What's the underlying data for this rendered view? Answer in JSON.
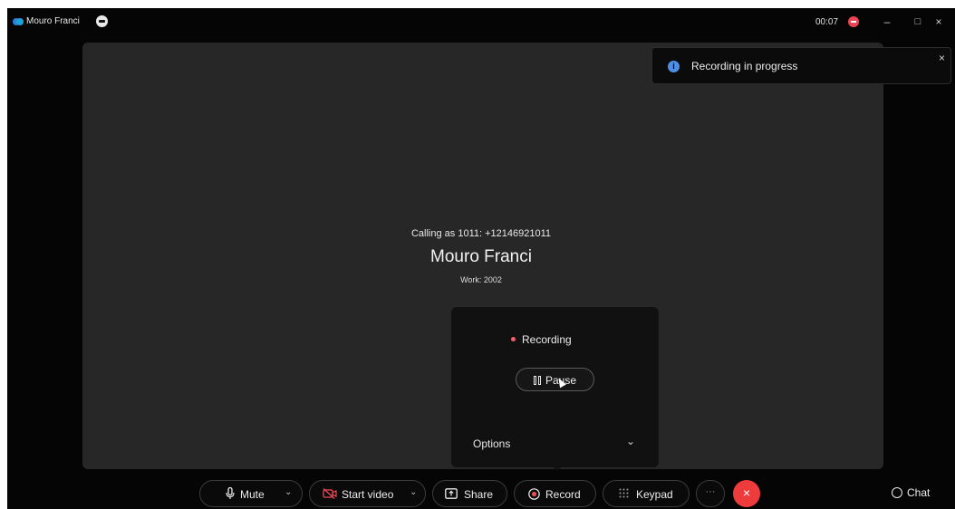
{
  "titlebar": {
    "app_name": "Mouro Franci",
    "timer": "00:07",
    "minimize": "–",
    "maximize": "□",
    "close": "×",
    "colors": {
      "recording_indicator": "#ec4452",
      "accent": "#4e8fe6"
    }
  },
  "toast": {
    "icon": "info-icon",
    "message": "Recording in progress",
    "close": "×"
  },
  "call": {
    "calling_as": "Calling as 1011: +12146921011",
    "callee_name": "Mouro Franci",
    "callee_detail": "Work: 2002"
  },
  "recording_popover": {
    "status": "Recording",
    "pause_label": "Pause",
    "options_label": "Options",
    "options_chevron": "⌄"
  },
  "controls": {
    "mute": {
      "label": "Mute",
      "icon": "microphone-icon",
      "chevron": "⌄"
    },
    "start_video": {
      "label": "Start video",
      "icon": "video-off-icon",
      "chevron": "⌄"
    },
    "share": {
      "label": "Share",
      "icon": "share-screen-icon"
    },
    "record": {
      "label": "Record",
      "icon": "record-icon"
    },
    "keypad": {
      "label": "Keypad",
      "icon": "keypad-icon"
    },
    "more": {
      "label": "···"
    },
    "end_call": {
      "label": "×",
      "color": "#ee3b3b"
    },
    "chat": {
      "label": "Chat",
      "icon": "chat-icon"
    }
  }
}
